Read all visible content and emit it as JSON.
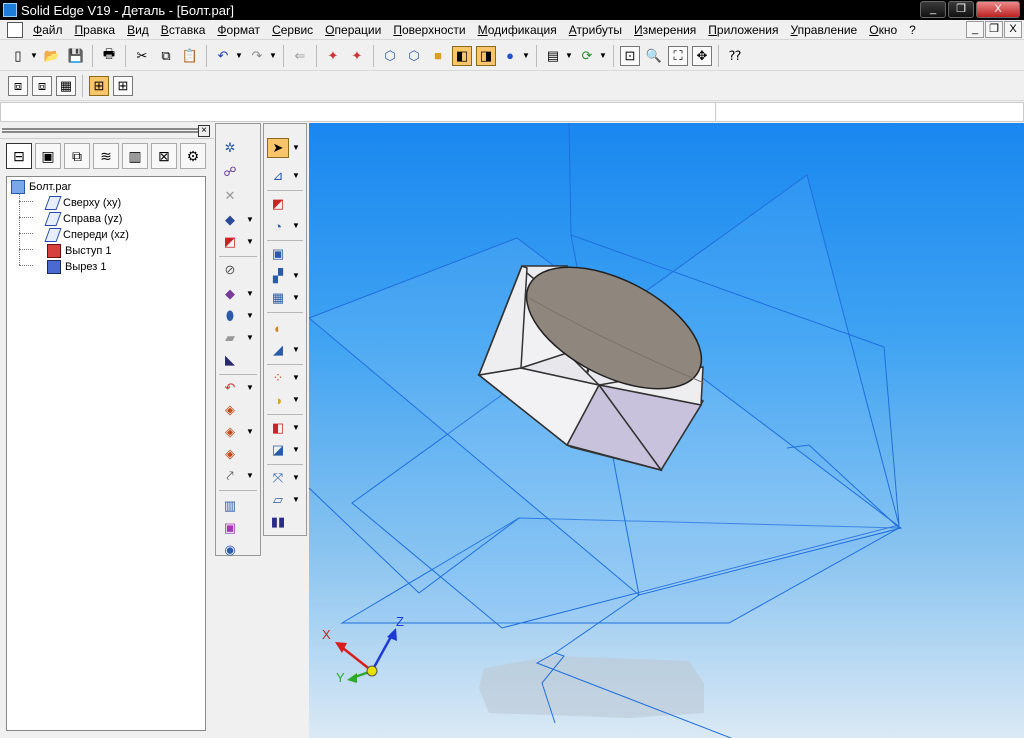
{
  "window": {
    "title": "Solid Edge V19 - Деталь - [Болт.par]",
    "buttons": [
      "_",
      "❐",
      "X"
    ]
  },
  "menu": [
    "Файл",
    "Правка",
    "Вид",
    "Вставка",
    "Формат",
    "Сервис",
    "Операции",
    "Поверхности",
    "Модификация",
    "Атрибуты",
    "Измерения",
    "Приложения",
    "Управление",
    "Окно",
    "?"
  ],
  "mdi_buttons": [
    "_",
    "❐",
    "X"
  ],
  "toolbar1": [
    "new-icon",
    "open-icon",
    "save-icon",
    "print-icon",
    "cut-icon",
    "copy-icon",
    "paste-icon",
    "undo-icon",
    "redo-icon",
    "paste-link-icon",
    "view-icon",
    "view-icon",
    "iso-icon",
    "front-icon",
    "shaded-icon",
    "shaded-edges-icon",
    "sphere-icon",
    "layer-icon",
    "rotate-icon",
    "zoom-area-icon",
    "zoom-icon",
    "fit-icon",
    "pan-icon",
    "help-icon"
  ],
  "toolbar2": [
    "feature-icon",
    "feature-icon",
    "feature-icon",
    "select-icon",
    "select-icon"
  ],
  "pathfinder": {
    "close": "×",
    "tree": [
      {
        "label": "Болт.par",
        "icon": "part"
      },
      {
        "label": "Сверху (xy)",
        "icon": "plane"
      },
      {
        "label": "Справа (yz)",
        "icon": "plane"
      },
      {
        "label": "Спереди (xz)",
        "icon": "plane"
      },
      {
        "label": "Выступ 1",
        "icon": "prot"
      },
      {
        "label": "Вырез 1",
        "icon": "cut"
      }
    ]
  },
  "triad": {
    "x": "X",
    "y": "Y",
    "z": "Z"
  },
  "colors": {
    "background_top": "#1987f0",
    "background_bottom": "#dbe9f5",
    "plane_edge": "#1f6fdc",
    "hex_light": "#e7e6e8",
    "hex_purple": "#c9c2dc",
    "top_face": "#8f867d"
  }
}
